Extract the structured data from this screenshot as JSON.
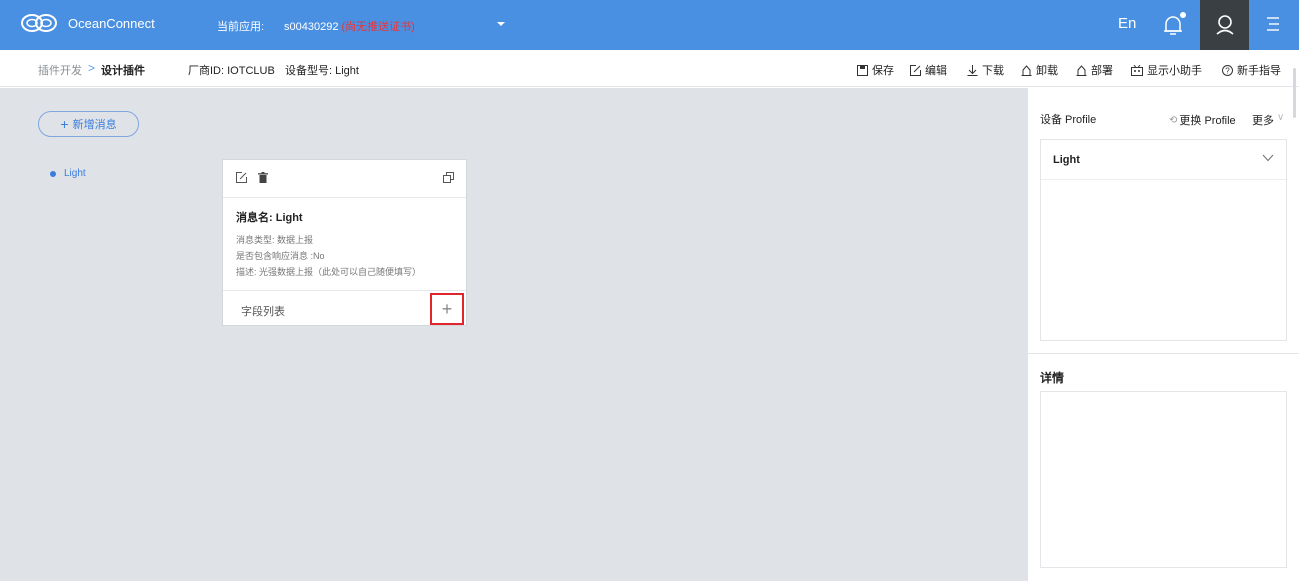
{
  "header": {
    "brand": "OceanConnect",
    "current_app_label": "当前应用:",
    "current_app_id": "s00430292",
    "current_app_warning": "(尚无推送证书)",
    "lang": "En",
    "icons": [
      "bell-icon",
      "user-icon",
      "menu-icon"
    ]
  },
  "subbar": {
    "breadcrumb_parent": "插件开发",
    "breadcrumb_sep": ">",
    "breadcrumb_current": "设计插件",
    "vendor": "厂商ID: IOTCLUB",
    "model": "设备型号: Light",
    "toolbar": {
      "save": "保存",
      "edit": "编辑",
      "download": "下载",
      "uninstall": "卸载",
      "deploy": "部署",
      "assistant": "显示小助手",
      "guide": "新手指导"
    }
  },
  "canvas": {
    "add_message": "新增消息",
    "tree_item": "Light",
    "card": {
      "title": "消息名: Light",
      "type_line": "消息类型: 数据上报",
      "response_line": "是否包含响应消息 :No",
      "desc_line": "描述: 光强数据上报（此处可以自己随便填写）",
      "field_list": "字段列表",
      "field_add": "+"
    }
  },
  "right_panel": {
    "title": "设备 Profile",
    "switch": "更换 Profile",
    "more": "更多",
    "profile_name": "Light",
    "detail_title": "详情"
  },
  "colors": {
    "topbar": "#4a90e2",
    "accent": "#3b7ddd",
    "warning": "#e8343a",
    "highlight_border": "#e0262c",
    "canvas_bg": "#dfe3e8"
  }
}
